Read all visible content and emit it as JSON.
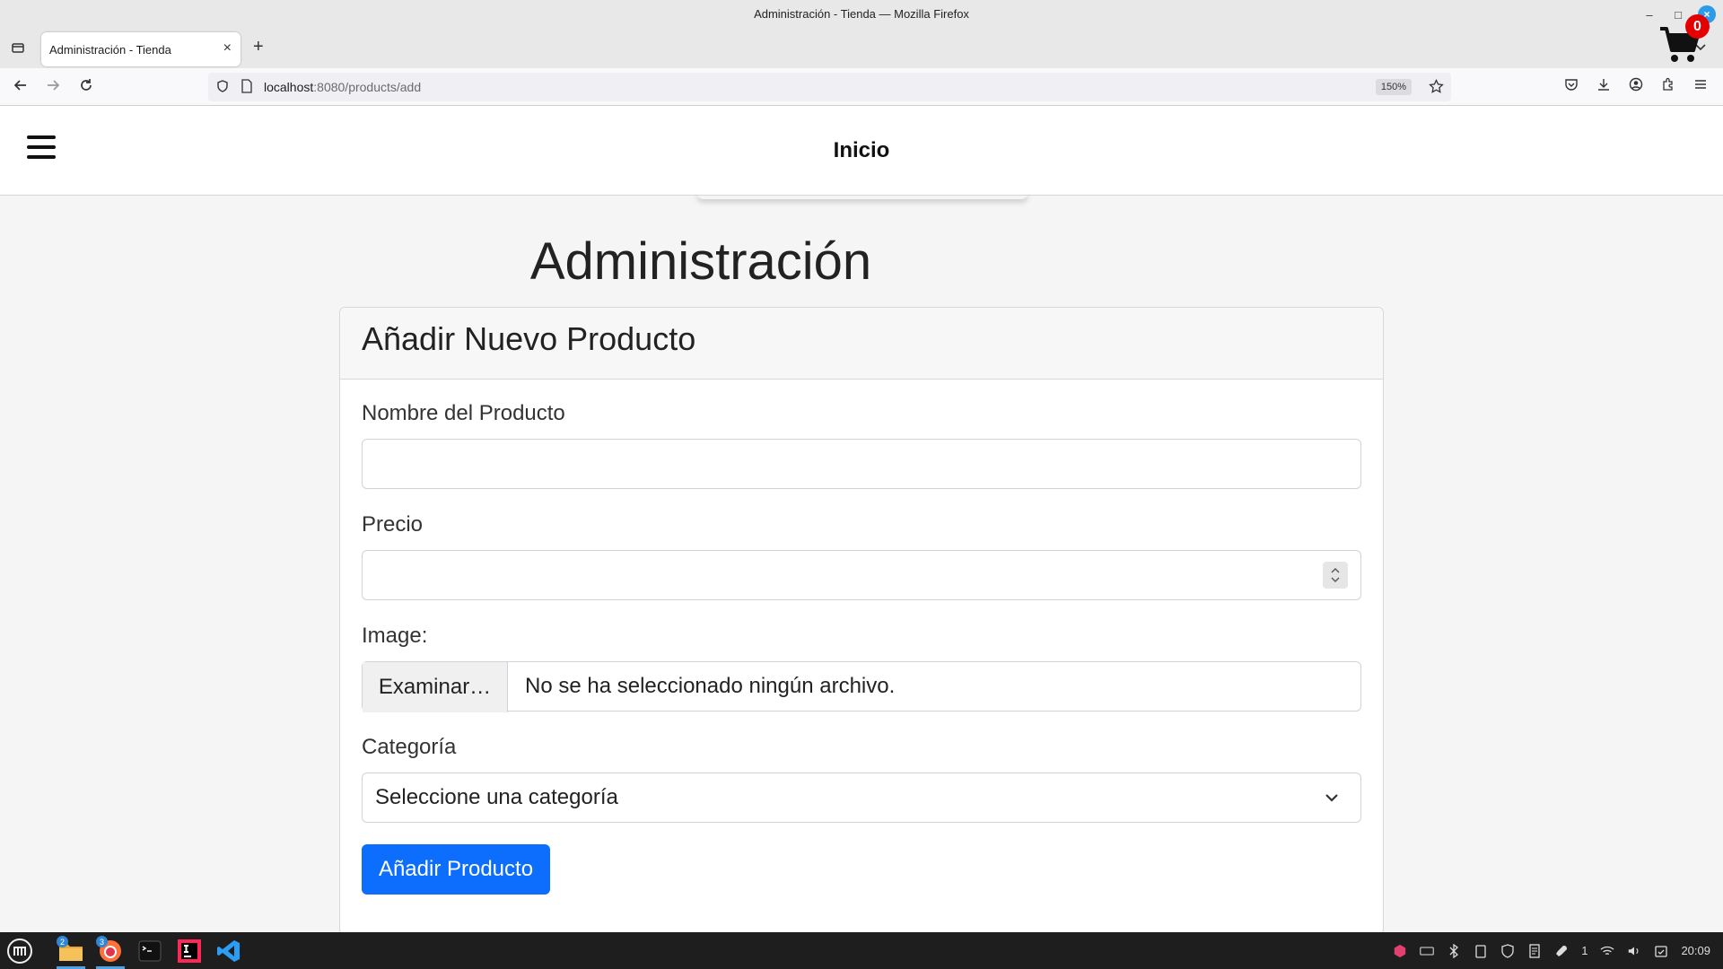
{
  "window": {
    "title": "Administración - Tienda — Mozilla Firefox",
    "minimize": "–",
    "maximize": "□",
    "close": "×"
  },
  "browser": {
    "tab_label": "Administración - Tienda",
    "tab_close": "×",
    "new_tab": "+",
    "url_host": "localhost",
    "url_path": ":8080/products/add",
    "zoom": "150%"
  },
  "site": {
    "title": "Inicio",
    "cart_count": "0"
  },
  "page": {
    "heading": "Administración",
    "card_title": "Añadir Nuevo Producto",
    "form": {
      "name_label": "Nombre del Producto",
      "name_value": "",
      "price_label": "Precio",
      "price_value": "",
      "image_label": "Image:",
      "file_button": "Examinar…",
      "file_status": "No se ha seleccionado ningún archivo.",
      "category_label": "Categoría",
      "category_selected": "Seleccione una categoría",
      "submit_label": "Añadir Producto"
    }
  },
  "taskbar": {
    "files_badge": "2",
    "firefox_badge": "3",
    "tray_count": "1",
    "clock": "20:09"
  },
  "colors": {
    "primary_button": "#0d6efd",
    "cart_badge": "#e40000",
    "firefox_close": "#2d9be8"
  }
}
